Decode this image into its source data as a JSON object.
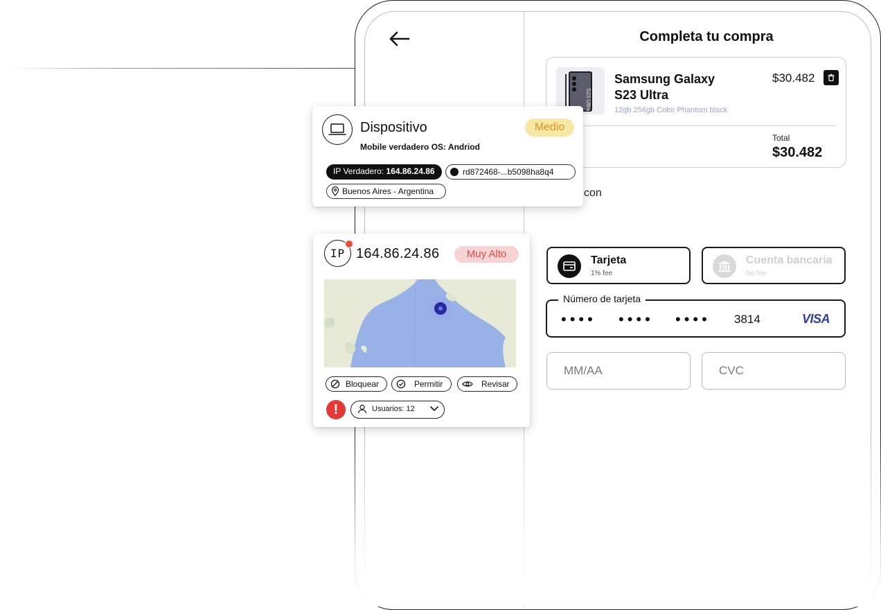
{
  "checkout": {
    "title": "Completa tu compra",
    "product": {
      "name_line1": "Samsung Galaxy",
      "name_line2": "S23 Ultra",
      "specs": "12gb 256gb Color Phantom black",
      "price": "$30.482",
      "thumb_text": "S23 Ultra",
      "total_label": "Total",
      "total_value": "$30.482"
    },
    "partial_text": "con",
    "payment_methods": [
      {
        "title": "Tarjeta",
        "fee": "1% fee",
        "icon": "card-icon",
        "selected": true
      },
      {
        "title": "Cuenta bancaria",
        "fee": "No fee",
        "icon": "bank-icon",
        "selected": false
      }
    ],
    "card_number": {
      "label": "Número de tarjeta",
      "masked_groups": [
        "••••",
        "••••",
        "••••"
      ],
      "last4": "3814",
      "brand": "VISA"
    },
    "expiry_placeholder": "MM/AA",
    "cvc_placeholder": "CVC"
  },
  "device_card": {
    "title": "Dispositivo",
    "subtitle": "Mobile verdadero OS: Andriod",
    "risk_badge": "Medio",
    "ip_chip_label": "IP Verdadero:",
    "ip_chip_value": "164.86.24.86",
    "hash": "rd872468-...b5098ha8q4",
    "location": "Buenos Aires - Argentina",
    "icon": "laptop-icon"
  },
  "ip_card": {
    "icon_text": "IP",
    "ip": "164.86.24.86",
    "risk_badge": "Muy Alto",
    "actions": [
      {
        "label": "Bloquear",
        "icon": "block-icon"
      },
      {
        "label": "Permitir",
        "icon": "check-circle-icon"
      },
      {
        "label": "Revisar",
        "icon": "eye-icon"
      }
    ],
    "warning": "!",
    "users_label": "Usuarios: 12"
  },
  "colors": {
    "medio_badge_bg": "#f7e8a6",
    "medio_badge_text": "#f0901a",
    "alto_badge_bg": "#f8d3d3",
    "alto_badge_text": "#e14b4b",
    "map_water": "#98b1e6",
    "map_land": "#e9ecd9",
    "map_pin": "#2a2aa0",
    "visa": "#2d3f9c"
  }
}
